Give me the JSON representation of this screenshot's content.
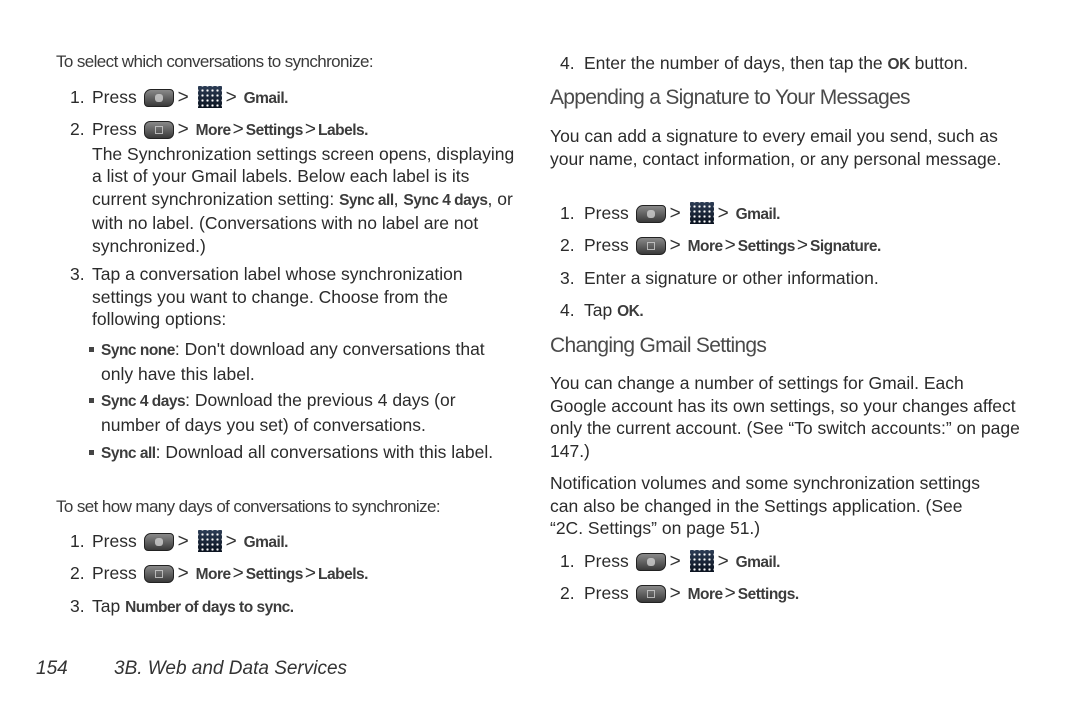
{
  "page": {
    "number": "154",
    "section": "3B. Web and Data Services"
  },
  "icons": {
    "home": "home-key-icon",
    "apps": "applications-icon",
    "menu": "menu-key-icon",
    "sep": ">"
  },
  "left": {
    "intro1": "To select which conversations to synchronize:",
    "steps1": [
      {
        "num": "1.",
        "press": "Press",
        "target": "Gmail."
      },
      {
        "num": "2.",
        "press": "Press",
        "path": [
          "More",
          "Settings",
          "Labels."
        ],
        "desc_a": "The Synchronization settings screen opens, displaying a list of your Gmail labels. Below each label is its current synchronization setting: ",
        "desc_b1": "Sync all",
        "desc_c": ", ",
        "desc_b2": "Sync 4 days",
        "desc_d": ", or with no label. (Conversations with no label are not synchronized.)"
      },
      {
        "num": "3.",
        "text": "Tap a conversation label whose synchronization settings you want to change. Choose from the following options:"
      }
    ],
    "options": [
      {
        "label": "Sync none",
        "text": ": Don't download any conversations that only have this label."
      },
      {
        "label": "Sync 4 days",
        "text": ": Download the previous 4 days (or number of days you set) of conversations."
      },
      {
        "label": "Sync all",
        "text": ": Download all conversations with this label."
      }
    ],
    "intro2": "To set how many days of conversations to synchronize:",
    "steps2": [
      {
        "num": "1.",
        "press": "Press",
        "target": "Gmail."
      },
      {
        "num": "2.",
        "press": "Press",
        "path": [
          "More",
          "Settings",
          "Labels."
        ]
      },
      {
        "num": "3.",
        "tap": "Tap",
        "target": "Number of days to sync."
      }
    ]
  },
  "right": {
    "step4": {
      "num": "4.",
      "text_a": "Enter the number of days, then tap the ",
      "bold": "OK",
      "text_b": " button."
    },
    "heading1": "Appending a Signature to Your Messages",
    "para1": "You can add a signature to every email you send, such as your name, contact information, or any personal message.",
    "steps1": [
      {
        "num": "1.",
        "press": "Press",
        "target": "Gmail."
      },
      {
        "num": "2.",
        "press": "Press",
        "path": [
          "More",
          "Settings",
          "Signature."
        ]
      },
      {
        "num": "3.",
        "text": "Enter a signature or other information."
      },
      {
        "num": "4.",
        "tap": "Tap",
        "target": "OK."
      }
    ],
    "heading2": "Changing Gmail Settings",
    "para2": "You can change a number of settings for Gmail. Each Google account has its own settings, so your changes affect only the current account. (See “To switch accounts:” on page 147.)",
    "para3": "Notification volumes and some synchronization settings can also be changed in the Settings application. (See “2C. Settings” on page 51.)",
    "steps2": [
      {
        "num": "1.",
        "press": "Press",
        "target": "Gmail."
      },
      {
        "num": "2.",
        "press": "Press",
        "path": [
          "More",
          "Settings."
        ]
      }
    ]
  }
}
